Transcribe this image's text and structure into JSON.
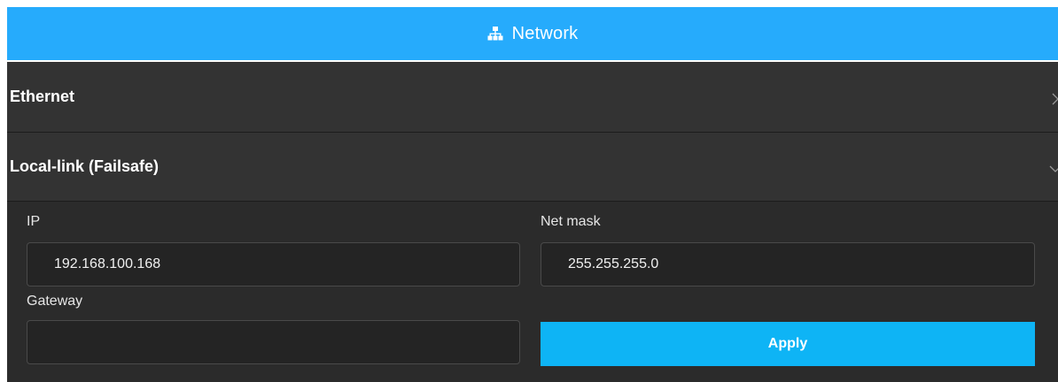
{
  "header": {
    "icon": "network-icon",
    "title": "Network"
  },
  "sections": [
    {
      "label": "Ethernet",
      "state": "collapsed",
      "chevron": "chevron-right-icon"
    },
    {
      "label": "Local-link (Failsafe)",
      "state": "expanded",
      "chevron": "chevron-down-icon"
    }
  ],
  "form": {
    "ip_label": "IP",
    "ip_value": "192.168.100.168",
    "netmask_label": "Net mask",
    "netmask_value": "255.255.255.0",
    "gateway_label": "Gateway",
    "gateway_value": "",
    "apply_label": "Apply"
  },
  "colors": {
    "header_bg": "#26abfc",
    "panel_bg": "#2b2b2b",
    "section_bg": "#333333",
    "apply_bg": "#0eb4f5"
  }
}
